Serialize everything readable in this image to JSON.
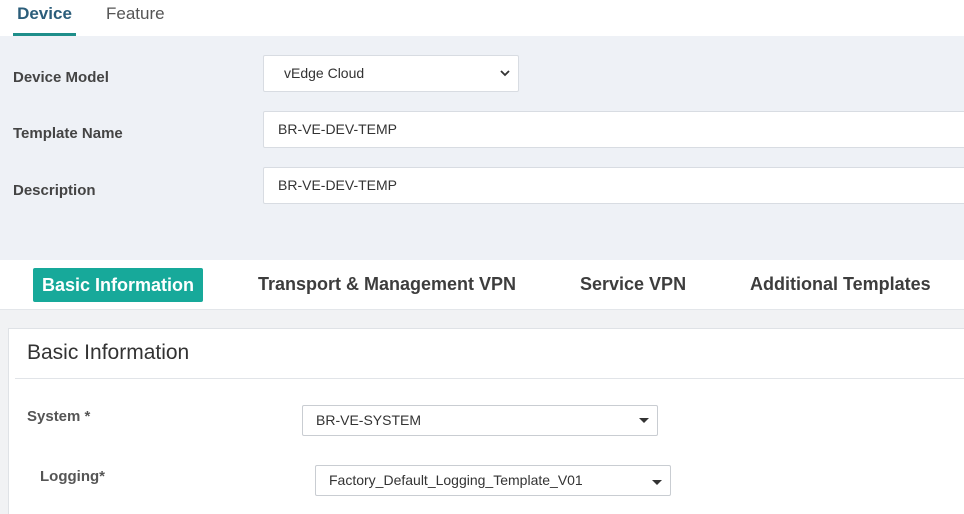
{
  "top_tabs": {
    "device": "Device",
    "feature": "Feature"
  },
  "form": {
    "device_model": {
      "label": "Device Model",
      "value": "vEdge Cloud"
    },
    "template_name": {
      "label": "Template Name",
      "value": "BR-VE-DEV-TEMP"
    },
    "description": {
      "label": "Description",
      "value": "BR-VE-DEV-TEMP"
    }
  },
  "section_tabs": [
    {
      "label": "Basic Information"
    },
    {
      "label": "Transport & Management VPN"
    },
    {
      "label": "Service VPN"
    },
    {
      "label": "Additional Templates"
    }
  ],
  "panel": {
    "title": "Basic Information",
    "system": {
      "label": "System *",
      "value": "BR-VE-SYSTEM"
    },
    "logging": {
      "label": "Logging*",
      "value": "Factory_Default_Logging_Template_V01"
    }
  },
  "colors": {
    "accent": "#17a99a",
    "tab_underline": "#1e8e8a",
    "form_bg": "#eef1f6"
  }
}
